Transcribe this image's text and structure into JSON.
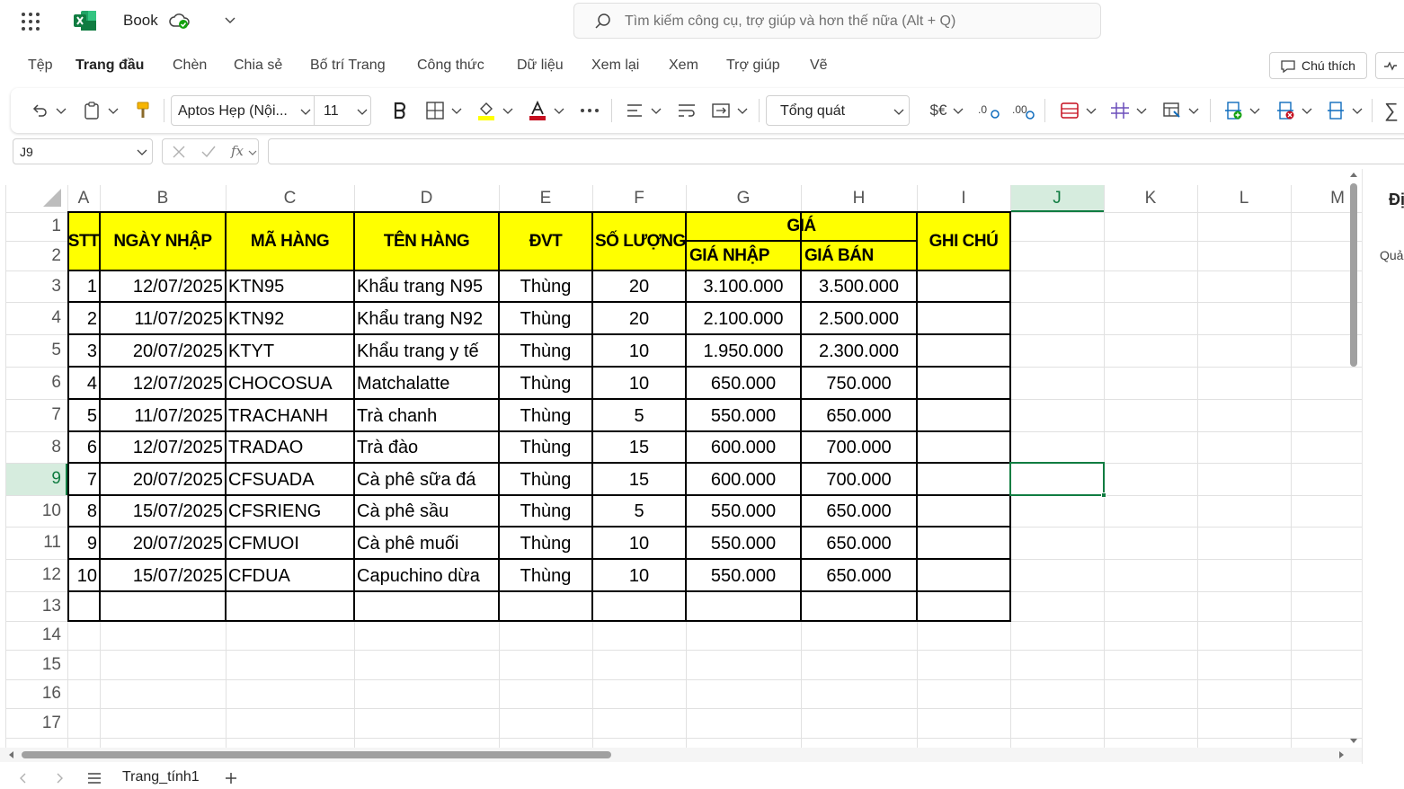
{
  "app": {
    "title": "Book",
    "search_placeholder": "Tìm kiếm công cụ, trợ giúp và hơn thế nữa (Alt + Q)",
    "brand_color": "#107C41"
  },
  "menu": {
    "tabs": [
      "Tệp",
      "Trang đầu",
      "Chèn",
      "Chia sẻ",
      "Bố trí Trang",
      "Công thức",
      "Dữ liệu",
      "Xem lại",
      "Xem",
      "Trợ giúp",
      "Vẽ"
    ],
    "active_tab": "Trang đầu",
    "comment_button": "Chú thích"
  },
  "ribbon": {
    "font_name": "Aptos Hẹp (Nội...",
    "font_size": "11",
    "number_format": "Tổng quát",
    "currency_label": "$€"
  },
  "formula_bar": {
    "name_box": "J9",
    "fx_label": "fx",
    "formula": ""
  },
  "grid": {
    "columns": [
      "A",
      "B",
      "C",
      "D",
      "E",
      "F",
      "G",
      "H",
      "I",
      "J",
      "K",
      "L",
      "M"
    ],
    "rows": [
      "1",
      "2",
      "3",
      "4",
      "5",
      "6",
      "7",
      "8",
      "9",
      "10",
      "11",
      "12",
      "13",
      "14",
      "15",
      "16",
      "17"
    ],
    "selected_cell": "J9",
    "selected_column": "J",
    "selected_row": "9",
    "header_fill": "#FFFF00",
    "selection_color": "#107C41"
  },
  "table": {
    "headers": {
      "stt": "STT",
      "ngay_nhap": "NGÀY NHẬP",
      "ma_hang": "MÃ HÀNG",
      "ten_hang": "TÊN HÀNG",
      "dvt": "ĐVT",
      "so_luong": "SỐ LƯỢNG",
      "gia": "GIÁ",
      "gia_nhap": "GIÁ NHẬP",
      "gia_ban": "GIÁ BÁN",
      "ghi_chu": "GHI CHÚ"
    },
    "rows": [
      {
        "stt": "1",
        "date": "12/07/2025",
        "code": "KTN95",
        "name": "Khẩu trang N95",
        "unit": "Thùng",
        "qty": "20",
        "buy": "3.100.000",
        "sell": "3.500.000"
      },
      {
        "stt": "2",
        "date": "11/07/2025",
        "code": "KTN92",
        "name": "Khẩu trang N92",
        "unit": "Thùng",
        "qty": "20",
        "buy": "2.100.000",
        "sell": "2.500.000"
      },
      {
        "stt": "3",
        "date": "20/07/2025",
        "code": "KTYT",
        "name": "Khẩu trang y tế",
        "unit": "Thùng",
        "qty": "10",
        "buy": "1.950.000",
        "sell": "2.300.000"
      },
      {
        "stt": "4",
        "date": "12/07/2025",
        "code": "CHOCOSUA",
        "name": "Matchalatte",
        "unit": "Thùng",
        "qty": "10",
        "buy": "650.000",
        "sell": "750.000"
      },
      {
        "stt": "5",
        "date": "11/07/2025",
        "code": "TRACHANH",
        "name": "Trà chanh",
        "unit": "Thùng",
        "qty": "5",
        "buy": "550.000",
        "sell": "650.000"
      },
      {
        "stt": "6",
        "date": "12/07/2025",
        "code": "TRADAO",
        "name": "Trà đào",
        "unit": "Thùng",
        "qty": "15",
        "buy": "600.000",
        "sell": "700.000"
      },
      {
        "stt": "7",
        "date": "20/07/2025",
        "code": "CFSUADA",
        "name": "Cà phê sữa đá",
        "unit": "Thùng",
        "qty": "15",
        "buy": "600.000",
        "sell": "700.000"
      },
      {
        "stt": "8",
        "date": "15/07/2025",
        "code": "CFSRIENG",
        "name": "Cà phê sầu",
        "unit": "Thùng",
        "qty": "5",
        "buy": "550.000",
        "sell": "650.000"
      },
      {
        "stt": "9",
        "date": "20/07/2025",
        "code": "CFMUOI",
        "name": "Cà phê muối",
        "unit": "Thùng",
        "qty": "10",
        "buy": "550.000",
        "sell": "650.000"
      },
      {
        "stt": "10",
        "date": "15/07/2025",
        "code": "CFDUA",
        "name": "Capuchino dừa",
        "unit": "Thùng",
        "qty": "10",
        "buy": "550.000",
        "sell": "650.000"
      }
    ]
  },
  "sheets": {
    "active": "Trang_tính1"
  },
  "side_pane": {
    "label_1": "Đị",
    "label_2": "Quả"
  }
}
